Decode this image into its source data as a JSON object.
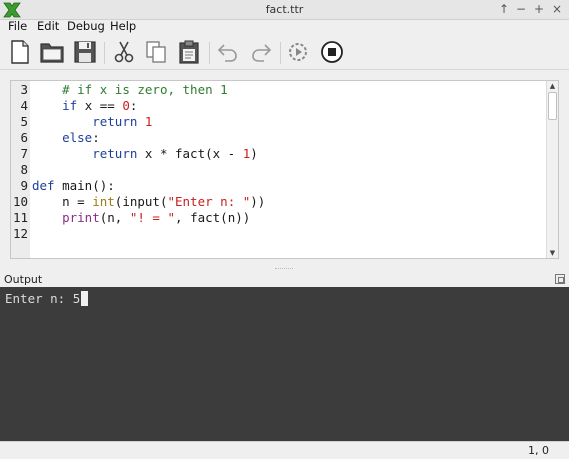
{
  "window": {
    "title": "fact.ttr",
    "controls": [
      "↑",
      "−",
      "+",
      "×"
    ]
  },
  "menu": [
    "File",
    "Edit",
    "Debug",
    "Help"
  ],
  "toolbar": {
    "icons": [
      "new-file-icon",
      "open-folder-icon",
      "save-icon",
      "cut-icon",
      "copy-icon",
      "paste-icon",
      "undo-icon",
      "redo-icon",
      "run-icon",
      "stop-icon"
    ]
  },
  "editor": {
    "lines": [
      {
        "n": "3",
        "tokens": [
          {
            "t": "    "
          },
          {
            "t": "# if x is zero, then 1",
            "c": "cm"
          }
        ]
      },
      {
        "n": "4",
        "tokens": [
          {
            "t": "    "
          },
          {
            "t": "if",
            "c": "kw"
          },
          {
            "t": " x == "
          },
          {
            "t": "0",
            "c": "num"
          },
          {
            "t": ":"
          }
        ]
      },
      {
        "n": "5",
        "tokens": [
          {
            "t": "        "
          },
          {
            "t": "return",
            "c": "kw"
          },
          {
            "t": " "
          },
          {
            "t": "1",
            "c": "num"
          }
        ]
      },
      {
        "n": "6",
        "tokens": [
          {
            "t": "    "
          },
          {
            "t": "else",
            "c": "kw"
          },
          {
            "t": ":"
          }
        ]
      },
      {
        "n": "7",
        "tokens": [
          {
            "t": "        "
          },
          {
            "t": "return",
            "c": "kw"
          },
          {
            "t": " x * fact(x - "
          },
          {
            "t": "1",
            "c": "num"
          },
          {
            "t": ")"
          }
        ]
      },
      {
        "n": "8",
        "tokens": []
      },
      {
        "n": "9",
        "tokens": [
          {
            "t": "def",
            "c": "kw"
          },
          {
            "t": " main():"
          }
        ]
      },
      {
        "n": "10",
        "tokens": [
          {
            "t": "    n = "
          },
          {
            "t": "int",
            "c": "bi"
          },
          {
            "t": "(input("
          },
          {
            "t": "\"Enter n: \"",
            "c": "str"
          },
          {
            "t": "))"
          }
        ]
      },
      {
        "n": "11",
        "tokens": [
          {
            "t": "    "
          },
          {
            "t": "print",
            "c": "pf"
          },
          {
            "t": "(n, "
          },
          {
            "t": "\"! = \"",
            "c": "str"
          },
          {
            "t": ", fact(n))"
          }
        ]
      },
      {
        "n": "12",
        "tokens": []
      }
    ]
  },
  "output": {
    "title": "Output",
    "console_text": "Enter n: 5"
  },
  "status": {
    "position": "1, 0"
  }
}
